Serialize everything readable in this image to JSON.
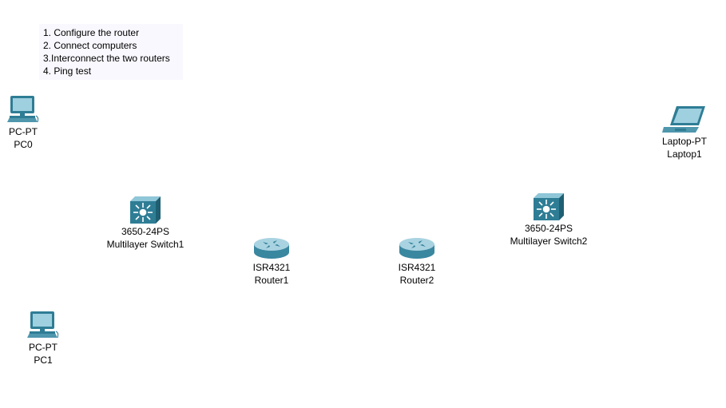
{
  "note": {
    "lines": [
      "1. Configure the router",
      "2. Connect computers",
      "3.Interconnect the two routers",
      "4. Ping test"
    ]
  },
  "devices": {
    "pc0": {
      "model": "PC-PT",
      "name": "PC0",
      "icon": "desktop-pc-icon"
    },
    "pc1": {
      "model": "PC-PT",
      "name": "PC1",
      "icon": "desktop-pc-icon"
    },
    "laptop1": {
      "model": "Laptop-PT",
      "name": "Laptop1",
      "icon": "laptop-icon"
    },
    "switch1": {
      "model": "3650-24PS",
      "name": "Multilayer Switch1",
      "icon": "multilayer-switch-icon"
    },
    "switch2": {
      "model": "3650-24PS",
      "name": "Multilayer Switch2",
      "icon": "multilayer-switch-icon"
    },
    "router1": {
      "model": "ISR4321",
      "name": "Router1",
      "icon": "router-icon"
    },
    "router2": {
      "model": "ISR4321",
      "name": "Router2",
      "icon": "router-icon"
    }
  },
  "colors": {
    "device_teal": "#2e7d95",
    "device_light": "#8fc6d8",
    "note_bg": "#f8f8fe"
  }
}
